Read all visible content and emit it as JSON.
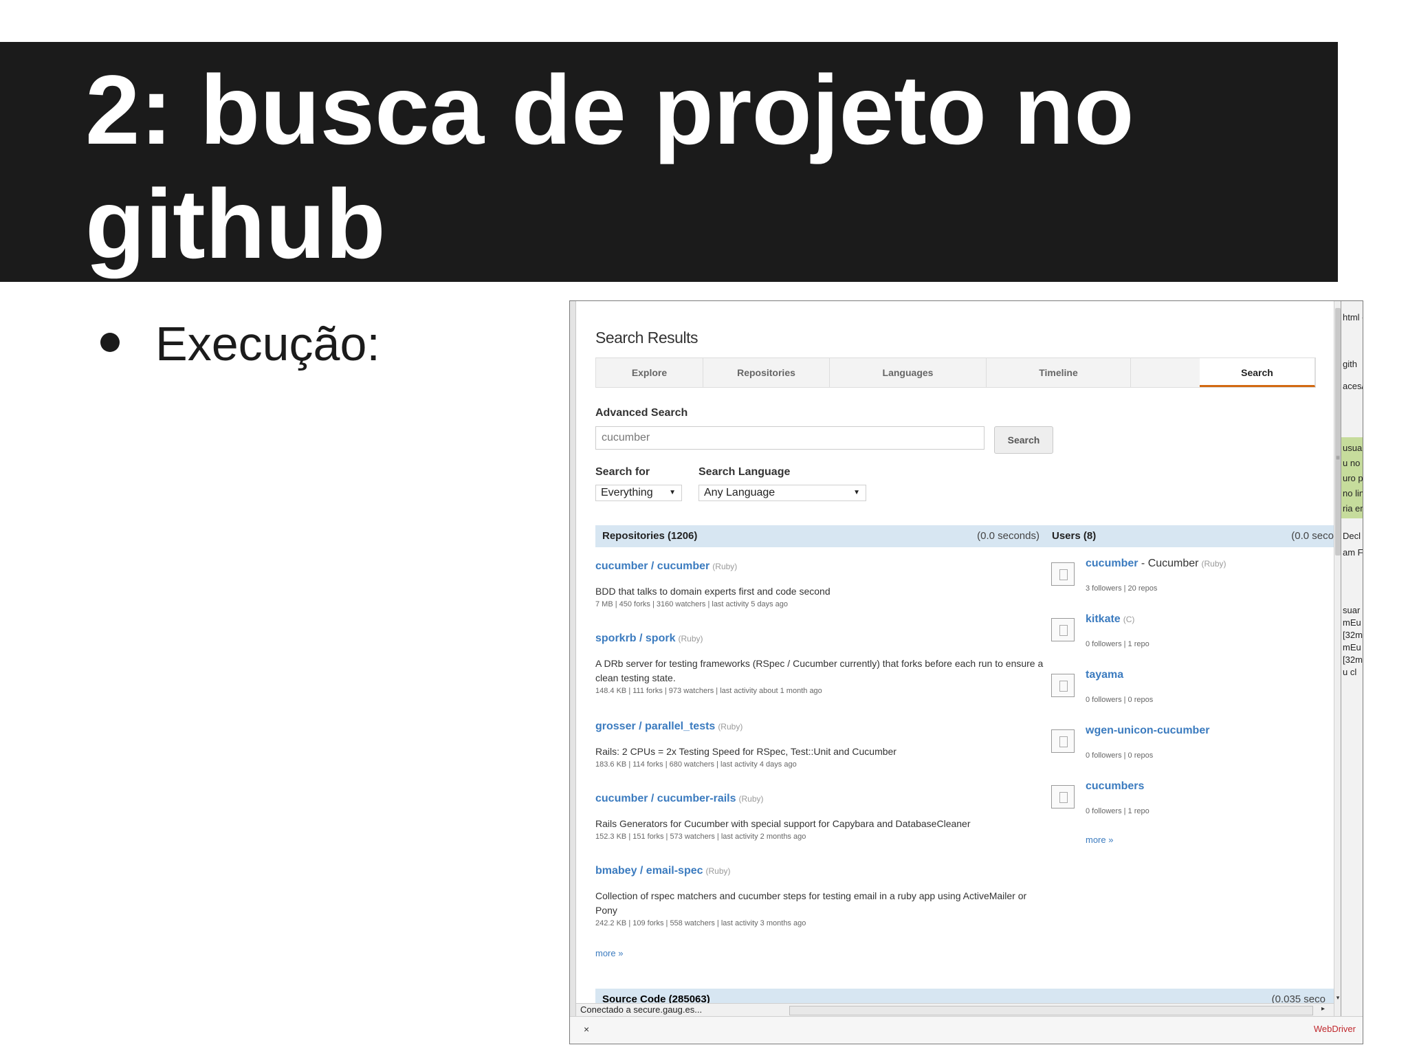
{
  "slide": {
    "title": "2: busca de projeto no github",
    "bullet": "Execução:"
  },
  "colors": {
    "title_bg": "#1b1b1b",
    "link": "#3b7bbf",
    "active_tab": "#d26911",
    "header_bg": "#d7e6f2",
    "webdriver": "#c0282d"
  },
  "github": {
    "heading": "Search Results",
    "tabs": [
      {
        "label": "Explore"
      },
      {
        "label": "Repositories"
      },
      {
        "label": "Languages"
      },
      {
        "label": "Timeline"
      },
      {
        "label": "Search",
        "active": true
      }
    ],
    "advanced_label": "Advanced Search",
    "query": "cucumber",
    "search_button": "Search",
    "search_for_label": "Search for",
    "search_for_value": "Everything",
    "language_label": "Search Language",
    "language_value": "Any Language",
    "repos_header": "Repositories (1206)",
    "repos_time": "(0.0 seconds)",
    "users_header": "Users (8)",
    "users_time": "(0.0 seco",
    "repositories": [
      {
        "name": "cucumber / cucumber",
        "lang": "(Ruby)",
        "desc": "BDD that talks to domain experts first and code second",
        "meta": "7 MB  |  450 forks  |  3160 watchers  |  last activity 5 days ago"
      },
      {
        "name": "sporkrb / spork",
        "lang": "(Ruby)",
        "desc": "A DRb server for testing frameworks (RSpec / Cucumber currently) that forks before each run to ensure a clean testing state.",
        "meta": "148.4 KB  |  111 forks  |  973 watchers  |  last activity about 1 month ago"
      },
      {
        "name": "grosser / parallel_tests",
        "lang": "(Ruby)",
        "desc": "Rails: 2 CPUs = 2x Testing Speed for RSpec, Test::Unit and Cucumber",
        "meta": "183.6 KB  |  114 forks  |  680 watchers  |  last activity 4 days ago"
      },
      {
        "name": "cucumber / cucumber-rails",
        "lang": "(Ruby)",
        "desc": "Rails Generators for Cucumber with special support for Capybara and DatabaseCleaner",
        "meta": "152.3 KB  |  151 forks  |  573 watchers  |  last activity 2 months ago"
      },
      {
        "name": "bmabey / email-spec",
        "lang": "(Ruby)",
        "desc": "Collection of rspec matchers and cucumber steps for testing email in a ruby app using ActiveMailer or Pony",
        "meta": "242.2 KB  |  109 forks  |  558 watchers  |  last activity 3 months ago"
      }
    ],
    "repos_more": "more »",
    "users": [
      {
        "name": "cucumber",
        "fullname": " - Cucumber",
        "lang": "(Ruby)",
        "meta": "3 followers  |  20 repos"
      },
      {
        "name": "kitkate",
        "fullname": "",
        "lang": "(C)",
        "meta": "0 followers  |  1 repo"
      },
      {
        "name": "tayama",
        "fullname": "",
        "lang": "",
        "meta": "0 followers  |  0 repos"
      },
      {
        "name": "wgen-unicon-cucumber",
        "fullname": "",
        "lang": "",
        "meta": "0 followers  |  0 repos"
      },
      {
        "name": "cucumbers",
        "fullname": "",
        "lang": "",
        "meta": "0 followers  |  1 repo"
      }
    ],
    "users_more": "more »",
    "source_header": "Source Code (285063)",
    "source_time": "(0.035 seco"
  },
  "browser": {
    "status": "Conectado a secure.gaug.es...",
    "close": "×",
    "webdriver": "WebDriver"
  },
  "side_panel": {
    "lines": [
      "html -",
      "gith",
      "aces/j",
      "usua",
      "u no",
      "uro p",
      "no lin",
      "ria en",
      "Decl",
      "am Fil",
      "suar",
      "mEu",
      "[32m",
      "mEu p",
      "[32m",
      "u cl"
    ]
  }
}
